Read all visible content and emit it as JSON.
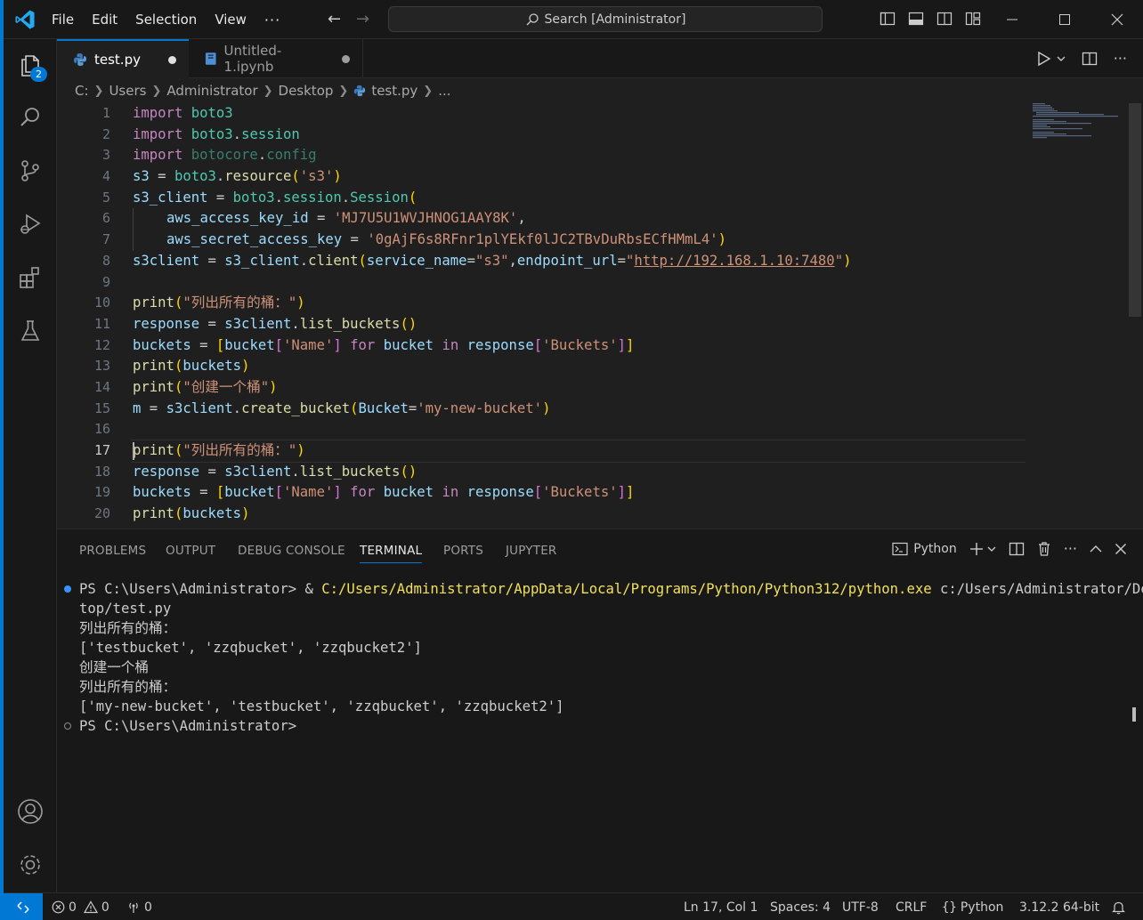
{
  "menu": [
    "File",
    "Edit",
    "Selection",
    "View",
    "···"
  ],
  "search": {
    "text": "Search [Administrator]"
  },
  "activity": {
    "explorer_badge": "2"
  },
  "tabs": [
    {
      "label": "test.py"
    },
    {
      "label": "Untitled-1.ipynb"
    }
  ],
  "breadcrumb": [
    "C:",
    "Users",
    "Administrator",
    "Desktop",
    "test.py",
    "..."
  ],
  "editor": {
    "line_numbers": [
      "1",
      "2",
      "3",
      "4",
      "5",
      "6",
      "7",
      "8",
      "9",
      "10",
      "11",
      "12",
      "13",
      "14",
      "15",
      "16",
      "17",
      "18",
      "19",
      "20"
    ],
    "current_line": "17",
    "lines": [
      [
        [
          "import ",
          "kw"
        ],
        [
          "boto3",
          "mod"
        ]
      ],
      [
        [
          "import ",
          "kw"
        ],
        [
          "boto3",
          "mod"
        ],
        [
          ".",
          ""
        ],
        [
          "session",
          "mod"
        ]
      ],
      [
        [
          "import ",
          "kw"
        ],
        [
          "botocore",
          "dimmod"
        ],
        [
          ".",
          ""
        ],
        [
          "config",
          "dimmod"
        ]
      ],
      [
        [
          "s3",
          "var"
        ],
        [
          " = ",
          ""
        ],
        [
          "boto3",
          "mod"
        ],
        [
          ".",
          ""
        ],
        [
          "resource",
          "fn"
        ],
        [
          "(",
          "p1"
        ],
        [
          "'s3'",
          "str"
        ],
        [
          ")",
          "p1"
        ]
      ],
      [
        [
          "s3_client",
          "var"
        ],
        [
          " = ",
          ""
        ],
        [
          "boto3",
          "mod"
        ],
        [
          ".",
          ""
        ],
        [
          "session",
          "mod"
        ],
        [
          ".",
          ""
        ],
        [
          "Session",
          "mod"
        ],
        [
          "(",
          "p1"
        ]
      ],
      [
        [
          "@indent",
          ""
        ],
        [
          "aws_access_key_id",
          "var"
        ],
        [
          " = ",
          ""
        ],
        [
          "'MJ7U5U1WVJHNOG1AAY8K'",
          "str"
        ],
        [
          ",",
          ""
        ]
      ],
      [
        [
          "@indent",
          ""
        ],
        [
          "aws_secret_access_key",
          "var"
        ],
        [
          " = ",
          ""
        ],
        [
          "'0gAjF6s8RFnr1plYEkf0lJC2TBvDuRbsECfHMmL4'",
          "str"
        ],
        [
          ")",
          "p1"
        ]
      ],
      [
        [
          "s3client",
          "var"
        ],
        [
          " = ",
          ""
        ],
        [
          "s3_client",
          "var"
        ],
        [
          ".",
          ""
        ],
        [
          "client",
          "fn"
        ],
        [
          "(",
          "p1"
        ],
        [
          "service_name",
          "var"
        ],
        [
          "=",
          ""
        ],
        [
          "\"s3\"",
          "str"
        ],
        [
          ",",
          ""
        ],
        [
          "endpoint_url",
          "var"
        ],
        [
          "=",
          ""
        ],
        [
          "\"",
          "str"
        ],
        [
          "http://192.168.1.10:7480",
          "url"
        ],
        [
          "\"",
          "str"
        ],
        [
          ")",
          "p1"
        ]
      ],
      [],
      [
        [
          "print",
          "fn"
        ],
        [
          "(",
          "p1"
        ],
        [
          "\"列出所有的桶：\"",
          "str"
        ],
        [
          ")",
          "p1"
        ]
      ],
      [
        [
          "response",
          "var"
        ],
        [
          " = ",
          ""
        ],
        [
          "s3client",
          "var"
        ],
        [
          ".",
          ""
        ],
        [
          "list_buckets",
          "fn"
        ],
        [
          "()",
          "p1"
        ]
      ],
      [
        [
          "buckets",
          "var"
        ],
        [
          " = ",
          ""
        ],
        [
          "[",
          "p1"
        ],
        [
          "bucket",
          "var"
        ],
        [
          "[",
          "p2"
        ],
        [
          "'Name'",
          "str"
        ],
        [
          "]",
          "p2"
        ],
        [
          " ",
          ""
        ],
        [
          "for ",
          "kw"
        ],
        [
          "bucket",
          "var"
        ],
        [
          " ",
          ""
        ],
        [
          "in ",
          "kw"
        ],
        [
          "response",
          "var"
        ],
        [
          "[",
          "p2"
        ],
        [
          "'Buckets'",
          "str"
        ],
        [
          "]",
          "p2"
        ],
        [
          "]",
          "p1"
        ]
      ],
      [
        [
          "print",
          "fn"
        ],
        [
          "(",
          "p1"
        ],
        [
          "buckets",
          "var"
        ],
        [
          ")",
          "p1"
        ]
      ],
      [
        [
          "print",
          "fn"
        ],
        [
          "(",
          "p1"
        ],
        [
          "\"创建一个桶\"",
          "str"
        ],
        [
          ")",
          "p1"
        ]
      ],
      [
        [
          "m",
          "var"
        ],
        [
          " = ",
          ""
        ],
        [
          "s3client",
          "var"
        ],
        [
          ".",
          ""
        ],
        [
          "create_bucket",
          "fn"
        ],
        [
          "(",
          "p1"
        ],
        [
          "Bucket",
          "var"
        ],
        [
          "=",
          ""
        ],
        [
          "'my-new-bucket'",
          "str"
        ],
        [
          ")",
          "p1"
        ]
      ],
      [],
      [
        [
          "print",
          "fn"
        ],
        [
          "(",
          "p1"
        ],
        [
          "\"列出所有的桶：\"",
          "str"
        ],
        [
          ")",
          "p1"
        ]
      ],
      [
        [
          "response",
          "var"
        ],
        [
          " = ",
          ""
        ],
        [
          "s3client",
          "var"
        ],
        [
          ".",
          ""
        ],
        [
          "list_buckets",
          "fn"
        ],
        [
          "()",
          "p1"
        ]
      ],
      [
        [
          "buckets",
          "var"
        ],
        [
          " = ",
          ""
        ],
        [
          "[",
          "p1"
        ],
        [
          "bucket",
          "var"
        ],
        [
          "[",
          "p2"
        ],
        [
          "'Name'",
          "str"
        ],
        [
          "]",
          "p2"
        ],
        [
          " ",
          ""
        ],
        [
          "for ",
          "kw"
        ],
        [
          "bucket",
          "var"
        ],
        [
          " ",
          ""
        ],
        [
          "in ",
          "kw"
        ],
        [
          "response",
          "var"
        ],
        [
          "[",
          "p2"
        ],
        [
          "'Buckets'",
          "str"
        ],
        [
          "]",
          "p2"
        ],
        [
          "]",
          "p1"
        ]
      ],
      [
        [
          "print",
          "fn"
        ],
        [
          "(",
          "p1"
        ],
        [
          "buckets",
          "var"
        ],
        [
          ")",
          "p1"
        ]
      ]
    ]
  },
  "panel": {
    "tabs": [
      "PROBLEMS",
      "OUTPUT",
      "DEBUG CONSOLE",
      "TERMINAL",
      "PORTS",
      "JUPYTER"
    ],
    "active_tab": "TERMINAL",
    "terminal_profile": "Python",
    "terminal_lines": [
      {
        "mark": "filled",
        "parts": [
          [
            "PS C:\\Users\\Administrator> & ",
            ""
          ],
          [
            "C:/Users/Administrator/AppData/Local/Programs/Python/Python312/python.exe",
            "tyellow"
          ],
          [
            " c:/Users/Administrator/Desk",
            ""
          ]
        ]
      },
      {
        "mark": "",
        "parts": [
          [
            "top/test.py",
            ""
          ]
        ]
      },
      {
        "mark": "",
        "parts": [
          [
            "列出所有的桶：",
            ""
          ]
        ]
      },
      {
        "mark": "",
        "parts": [
          [
            "['testbucket', 'zzqbucket', 'zzqbucket2']",
            ""
          ]
        ]
      },
      {
        "mark": "",
        "parts": [
          [
            "创建一个桶",
            ""
          ]
        ]
      },
      {
        "mark": "",
        "parts": [
          [
            "列出所有的桶：",
            ""
          ]
        ]
      },
      {
        "mark": "",
        "parts": [
          [
            "['my-new-bucket', 'testbucket', 'zzqbucket', 'zzqbucket2']",
            ""
          ]
        ]
      },
      {
        "mark": "hollow",
        "parts": [
          [
            "PS C:\\Users\\Administrator>",
            ""
          ]
        ]
      }
    ]
  },
  "status": {
    "errors": "0",
    "warnings": "0",
    "ports": "0",
    "position": "Ln 17, Col 1",
    "spaces": "Spaces: 4",
    "encoding": "UTF-8",
    "eol": "CRLF",
    "language": "Python",
    "interpreter": "3.12.2 64-bit"
  },
  "colors": {
    "accent": "#0078d4",
    "editor_bg": "#1f1f1f",
    "chrome_bg": "#181818"
  }
}
